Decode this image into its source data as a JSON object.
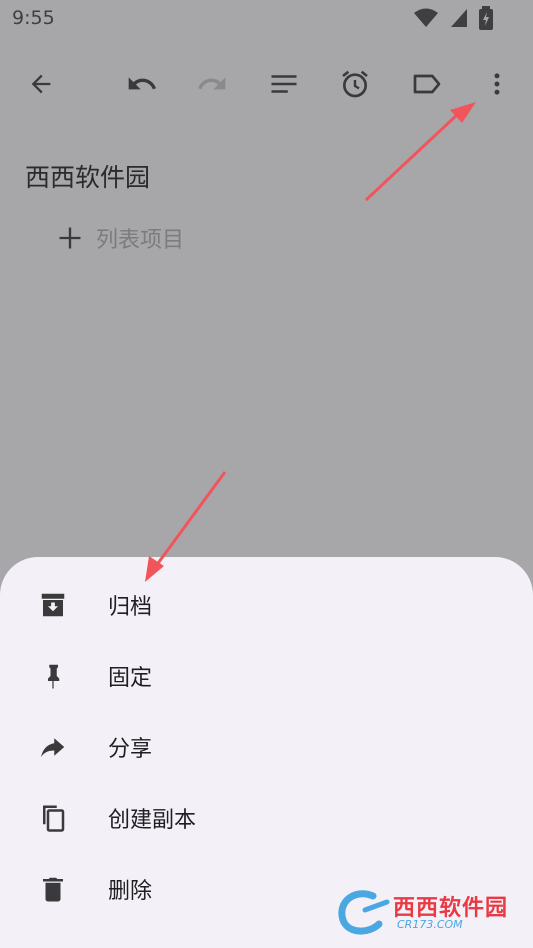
{
  "status_bar": {
    "time": "9:55"
  },
  "toolbar": {
    "icons": [
      "back-arrow-icon",
      "undo-icon",
      "redo-icon",
      "format-list-icon",
      "alarm-icon",
      "label-icon",
      "more-vert-icon"
    ]
  },
  "note": {
    "title": "西西软件园",
    "add_item_label": "列表项目"
  },
  "menu": {
    "items": [
      {
        "label": "归档",
        "icon": "archive-icon"
      },
      {
        "label": "固定",
        "icon": "pin-icon"
      },
      {
        "label": "分享",
        "icon": "share-icon"
      },
      {
        "label": "创建副本",
        "icon": "copy-icon"
      },
      {
        "label": "删除",
        "icon": "delete-icon"
      }
    ]
  },
  "watermark": {
    "brand": "西西软件园",
    "domain": "CR173.COM"
  },
  "colors": {
    "scrim": "#a7a7aa",
    "sheet": "#f4f0f8",
    "annotation_arrow": "#f2545b",
    "icon": "#3a3a3c"
  }
}
